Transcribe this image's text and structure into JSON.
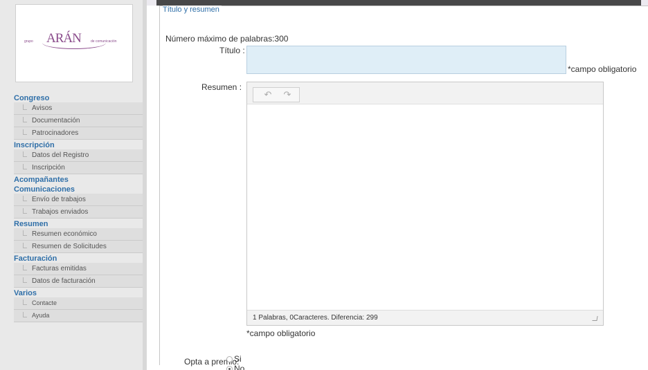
{
  "logo": {
    "left_text": "grupo",
    "main_text": "ARÁN",
    "right_text": "de comunicación"
  },
  "sidebar": {
    "sections": [
      {
        "title": "Congreso",
        "items": [
          "Avisos",
          "Documentación",
          "Patrocinadores"
        ]
      },
      {
        "title": "Inscripción",
        "items": [
          "Datos del Registro",
          "Inscripción"
        ]
      },
      {
        "title": "Acompañantes",
        "items": []
      },
      {
        "title": "Comunicaciones",
        "items": [
          "Envío de trabajos",
          "Trabajos enviados"
        ]
      },
      {
        "title": "Resumen",
        "items": [
          "Resumen económico",
          "Resumen de Solicitudes"
        ]
      },
      {
        "title": "Facturación",
        "items": [
          "Facturas emitidas",
          "Datos de facturación"
        ]
      },
      {
        "title": "Varios",
        "items": [
          "Contacte",
          "Ayuda"
        ]
      }
    ]
  },
  "form": {
    "legend": "Título y resumen",
    "max_words": "Número máximo de palabras:300",
    "titulo_label": "Título :",
    "titulo_value": "",
    "required_note_1": "*campo obligatorio",
    "resumen_label": "Resumen :",
    "editor": {
      "undo_icon": "undo-icon",
      "redo_icon": "redo-icon",
      "status": "1 Palabras, 0Caracteres. Diferencia: 299"
    },
    "required_note_2": "*campo obligatorio",
    "premio_label": "Opta a premio:",
    "premio_options": [
      {
        "label": "Si",
        "checked": false
      },
      {
        "label": "No",
        "checked": true
      }
    ]
  }
}
